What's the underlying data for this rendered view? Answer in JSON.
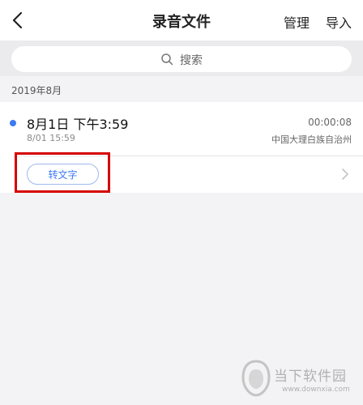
{
  "header": {
    "title": "录音文件",
    "manage_label": "管理",
    "import_label": "导入"
  },
  "search": {
    "placeholder": "搜索"
  },
  "groups": [
    {
      "header": "2019年8月",
      "items": [
        {
          "title": "8月1日 下午3:59",
          "subtitle": "8/01  15:59",
          "duration": "00:00:08",
          "location": "中国大理白族自治州",
          "action_label": "转文字"
        }
      ]
    }
  ],
  "icons": {
    "back": "chevron-left-icon",
    "search": "search-icon",
    "row_arrow": "chevron-right-icon"
  },
  "colors": {
    "accent": "#3c7af2",
    "highlight_box": "#d60000"
  },
  "watermark": {
    "name": "当下软件园",
    "url": "www.downxia.com"
  }
}
